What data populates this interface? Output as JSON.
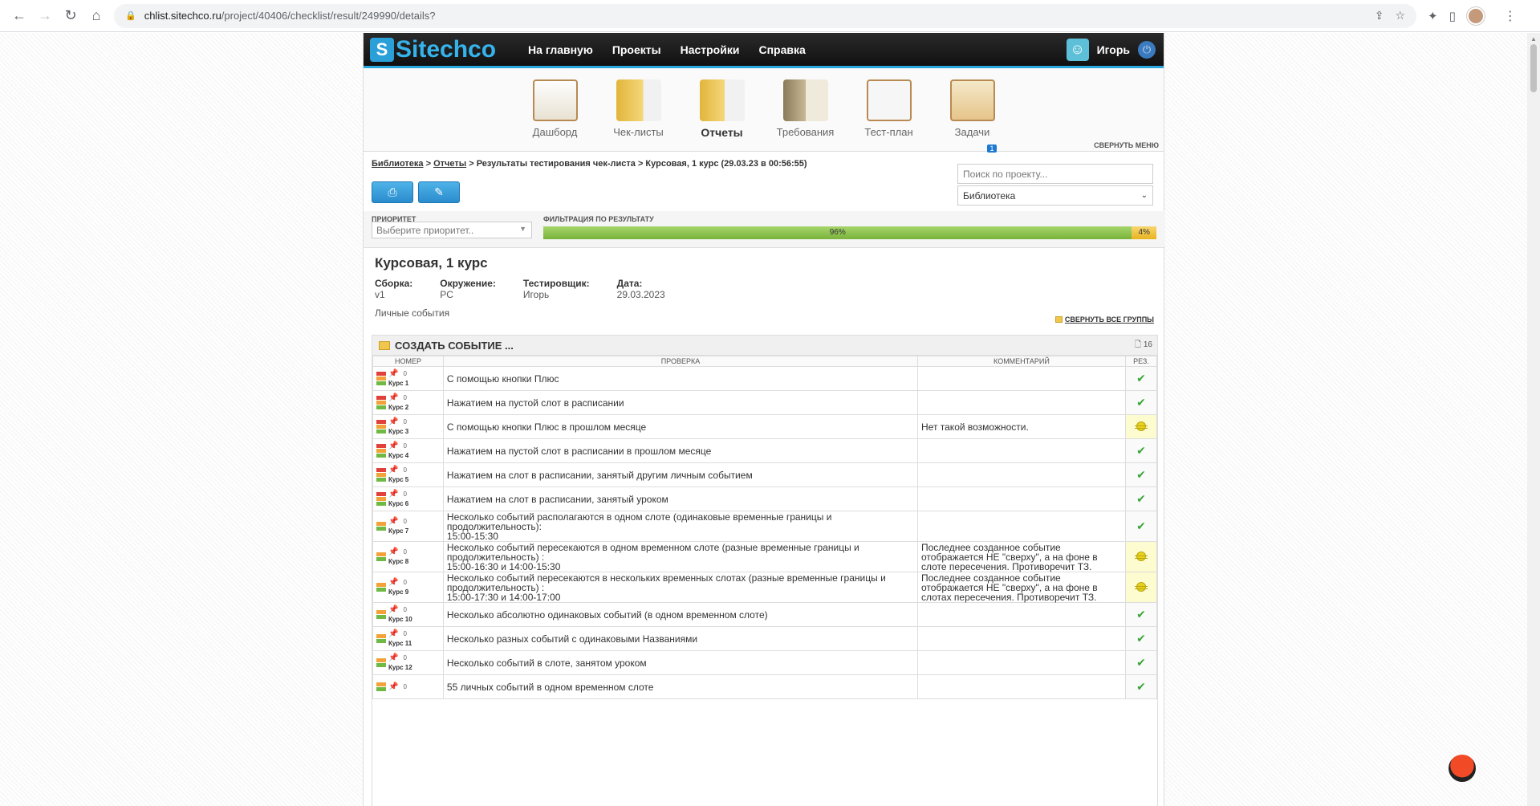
{
  "browser": {
    "url_host": "chlist.sitechco.ru",
    "url_path": "/project/40406/checklist/result/249990/details?"
  },
  "topnav": {
    "logo": "Sitechco",
    "menu": [
      "На главную",
      "Проекты",
      "Настройки",
      "Справка"
    ],
    "user_name": "Игорь"
  },
  "iconmenu": {
    "items": [
      {
        "label": "Дашборд",
        "icon": "dashboard-icon"
      },
      {
        "label": "Чек-листы",
        "icon": "checklists-icon"
      },
      {
        "label": "Отчеты",
        "icon": "reports-icon",
        "active": true
      },
      {
        "label": "Требования",
        "icon": "requirements-icon"
      },
      {
        "label": "Тест-план",
        "icon": "testplan-icon"
      },
      {
        "label": "Задачи",
        "icon": "tasks-icon",
        "badge": "1"
      }
    ],
    "collapse": "СВЕРНУТЬ МЕНЮ"
  },
  "breadcrumb": {
    "library": "Библиотека",
    "reports": "Отчеты",
    "rest": "> Результаты тестирования чек-листа > Курсовая, 1 курс (29.03.23 в 00:56:55)"
  },
  "search": {
    "placeholder": "Поиск по проекту..."
  },
  "scope_select": {
    "value": "Библиотека"
  },
  "filters": {
    "priority_label": "ПРИОРИТЕТ",
    "priority_placeholder": "Выберите приоритет..",
    "result_label": "ФИЛЬТРАЦИЯ ПО РЕЗУЛЬТАТУ",
    "passed_pct": "96%",
    "failed_pct": "4%",
    "passed_fraction": 0.96
  },
  "report": {
    "title": "Курсовая, 1 курс",
    "meta": [
      {
        "key": "Сборка:",
        "val": "v1"
      },
      {
        "key": "Окружение:",
        "val": "PC"
      },
      {
        "key": "Тестировщик:",
        "val": "Игорь"
      },
      {
        "key": "Дата:",
        "val": "29.03.2023"
      }
    ],
    "description": "Личные события",
    "collapse_all": "СВЕРНУТЬ ВСЕ ГРУППЫ"
  },
  "group": {
    "title": "СОЗДАТЬ СОБЫТИЕ ...",
    "count": "16",
    "columns": [
      "НОМЕР",
      "ПРОВЕРКА",
      "КОММЕНТАРИЙ",
      "РЕЗ."
    ],
    "rows": [
      {
        "num": "Курс 1",
        "pri": "high",
        "check": "С помощью кнопки Плюс",
        "comment": "",
        "result": "pass"
      },
      {
        "num": "Курс 2",
        "pri": "high",
        "check": "Нажатием на пустой слот в расписании",
        "comment": "",
        "result": "pass"
      },
      {
        "num": "Курс 3",
        "pri": "high",
        "check": "С помощью кнопки Плюс в прошлом месяце",
        "comment": "Нет такой возможности.",
        "result": "bug"
      },
      {
        "num": "Курс 4",
        "pri": "high",
        "check": "Нажатием на пустой слот в расписании в прошлом месяце",
        "comment": "",
        "result": "pass"
      },
      {
        "num": "Курс 5",
        "pri": "high",
        "check": "Нажатием на слот в расписании, занятый другим личным событием",
        "comment": "",
        "result": "pass"
      },
      {
        "num": "Курс 6",
        "pri": "high",
        "check": "Нажатием на слот в расписании, занятый уроком",
        "comment": "",
        "result": "pass"
      },
      {
        "num": "Курс 7",
        "pri": "mid",
        "check": "Несколько событий располагаются в одном слоте (одинаковые временные границы и продолжительность):\n15:00-15:30",
        "comment": "",
        "result": "pass"
      },
      {
        "num": "Курс 8",
        "pri": "mid",
        "check": "Несколько событий пересекаются в одном временном слоте (разные временные границы и продолжительность) :\n15:00-16:30 и 14:00-15:30",
        "comment": "Последнее созданное событие отображается НЕ \"сверху\", а на фоне в слоте пересечения. Противоречит ТЗ.",
        "result": "bug"
      },
      {
        "num": "Курс 9",
        "pri": "mid",
        "check": "Несколько событий пересекаются в нескольких временных слотах (разные временные границы и продолжительность) :\n15:00-17:30 и 14:00-17:00",
        "comment": "Последнее созданное событие отображается НЕ \"сверху\", а на фоне в слотах пересечения. Противоречит ТЗ.",
        "result": "bug"
      },
      {
        "num": "Курс 10",
        "pri": "mid",
        "check": "Несколько абсолютно одинаковых событий (в одном временном слоте)",
        "comment": "",
        "result": "pass"
      },
      {
        "num": "Курс 11",
        "pri": "mid",
        "check": "Несколько разных событий с одинаковыми Названиями",
        "comment": "",
        "result": "pass"
      },
      {
        "num": "Курс 12",
        "pri": "mid",
        "check": "Несколько событий в слоте, занятом уроком",
        "comment": "",
        "result": "pass"
      },
      {
        "num": "",
        "pri": "mid",
        "check": "55 личных событий в одном временном слоте",
        "comment": "",
        "result": "pass"
      }
    ]
  }
}
